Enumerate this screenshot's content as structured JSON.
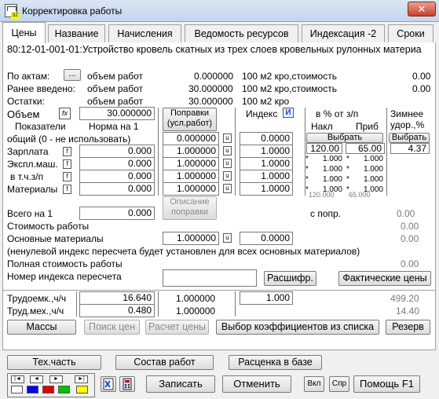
{
  "window": {
    "title": "Корректировка работы",
    "close": "✕"
  },
  "tabs": [
    "Цены",
    "Название",
    "Начисления",
    "Ведомость ресурсов",
    "Индексация -2",
    "Сроки"
  ],
  "work_title": "80:12-01-001-01:Устройство кровель скатных из трех слоев кровельных рулонных материа",
  "volumes": {
    "acts": {
      "label": "По актам:",
      "btn": "...",
      "kind": "объем работ",
      "value": "0.000000",
      "unit": "100 м2 кро,стоимость",
      "cost": "0.00"
    },
    "earlier": {
      "label": "Ранее введено:",
      "kind": "объем работ",
      "value": "30.000000",
      "unit": "100 м2 кро,стоимость",
      "cost": "0.00"
    },
    "rest": {
      "label": "Остатки:",
      "kind": "объем работ",
      "value": "30.000000",
      "unit": "100 м2 кро"
    }
  },
  "volume": {
    "label": "Объем",
    "fx": "fx",
    "value": "30.000000"
  },
  "buttons": {
    "corrections": "Поправки\n(усл.работ)",
    "index_label": "Индекс",
    "index_btn": "И",
    "percent_label": "в % от з/п",
    "winter": "Зимнее\nудор.,%",
    "nakl": "Накл",
    "prib": "Приб",
    "choose": "Выбрать",
    "choose2": "Выбрать",
    "desc_corr": "Описание\nпоправки"
  },
  "norm": {
    "indicators": "Показатели",
    "norm_per1": "Норма на 1",
    "common": "общий (0 - не использовать)",
    "common_val": "0.000000",
    "common_idx": "0.0000",
    "rows": [
      {
        "label": "Зарплата",
        "norm": "0.000",
        "corr": "1.000000",
        "index": "1.0000"
      },
      {
        "label": "Экспл.маш.",
        "norm": "0.000",
        "corr": "1.000000",
        "index": "1.0000"
      },
      {
        "label": "в т.ч.з/п",
        "norm": "0.000",
        "corr": "1.000000",
        "index": "1.0000"
      },
      {
        "label": "Материалы",
        "norm": "0.000",
        "corr": "1.000000",
        "index": "1.0000"
      }
    ],
    "nakl_main": "120.00",
    "prib_main": "65.00",
    "winter_val": "4.37",
    "nakl_rows": [
      "1.000",
      "1.000",
      "1.000",
      "1.000"
    ],
    "prib_rows": [
      "1.000",
      "1.000",
      "1.000",
      "1.000"
    ],
    "nakl_total": "120.000",
    "prib_total": "65.000"
  },
  "totals": {
    "total1_label": "Всего на 1",
    "total1_val": "0.000",
    "with_corr": "с попр.",
    "with_corr_val": "0.00",
    "cost_label": "Стоимость работы",
    "cost_val": "0.00",
    "main_mat_label": "Основные материалы",
    "main_mat_corr": "1.000000",
    "main_mat_idx": "0.0000",
    "main_mat_val": "0.00",
    "note": "(ненулевой индекс пересчета будет установлен для всех основных материалов)",
    "full_cost_label": "Полная стоимость работы",
    "full_cost_val": "0.00",
    "reindex_label": "Номер индекса пересчета",
    "decode": "Расшифр.",
    "actual_prices": "Фактические цены"
  },
  "labor": {
    "trud_label": "Трудоемк.,ч/ч",
    "trud_val": "16.640",
    "trud_coef": "1.000000",
    "trud_idx": "1.000",
    "trud_total": "499.20",
    "mech_label": "Труд.мех.,ч/ч",
    "mech_val": "0.480",
    "mech_coef": "1.000000",
    "mech_total": "14.40"
  },
  "bottom_buttons": {
    "masses": "Массы",
    "search_prices": "Поиск цен",
    "calc_prices": "Расчет цены",
    "choose_coef": "Выбор коэффициентов из списка",
    "reserve": "Резерв",
    "tech_part": "Тех.часть",
    "composition": "Состав работ",
    "rate_base": "Расценка в базе",
    "save": "Записать",
    "cancel": "Отменить",
    "vkl": "Вкл",
    "spr": "Спр",
    "help": "Помощь F1"
  },
  "colors": {
    "accent_blue": "#1a4fd8",
    "red": "#e00000",
    "green": "#00c000",
    "yellow": "#ffff00",
    "blue": "#0000ff"
  }
}
